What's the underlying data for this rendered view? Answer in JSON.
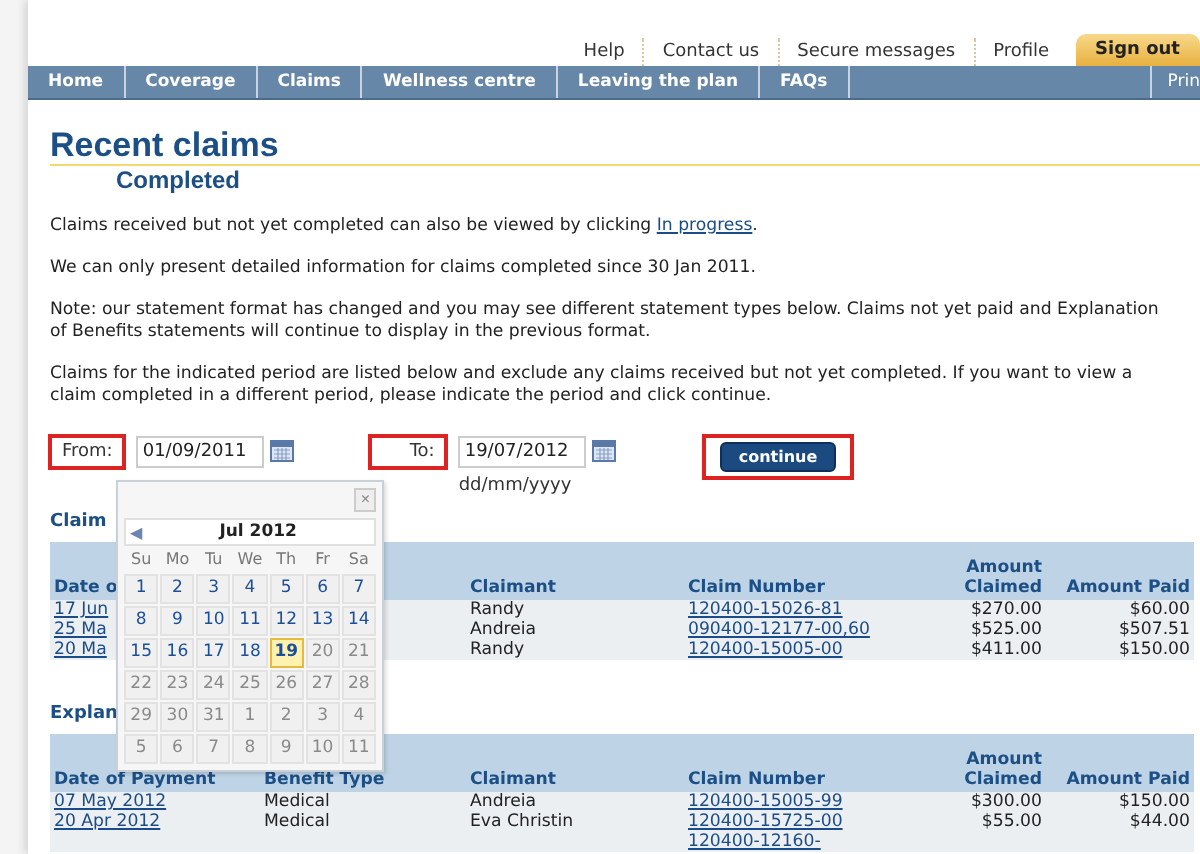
{
  "top_links": [
    {
      "label": "Help",
      "kind": "link"
    },
    {
      "label": "Contact us",
      "kind": "link"
    },
    {
      "label": "Secure messages",
      "kind": "link"
    },
    {
      "label": "Profile",
      "kind": "link"
    },
    {
      "label": "Sign out",
      "kind": "tab"
    }
  ],
  "nav": {
    "items": [
      "Home",
      "Coverage",
      "Claims",
      "Wellness centre",
      "Leaving the plan",
      "FAQs"
    ],
    "print": "Prin"
  },
  "heading": {
    "title": "Recent claims",
    "subtitle": "Completed"
  },
  "paragraphs": [
    {
      "text": "Claims received but not yet completed can also be viewed by clicking ",
      "link": "In progress",
      "after": "."
    },
    {
      "text": "We can only present detailed information for claims completed since 30 Jan 2011."
    },
    {
      "text": "Note: our statement format has changed and you may see different statement types below. Claims not yet paid and Explanation of Benefits statements will continue to display in the previous format."
    },
    {
      "text": "Claims for the indicated period are listed below and exclude any claims received but not yet completed. If you want to view a claim completed in a different period, please indicate the period and click continue."
    }
  ],
  "period": {
    "from_label": {
      "text": "From:",
      "highlighted": true
    },
    "from_value": "01/09/2011",
    "to_label": {
      "text": "To:",
      "highlighted": true
    },
    "to_value": "19/07/2012",
    "format_hint": "dd/mm/yyyy",
    "continue": {
      "label": "continue",
      "highlighted": true
    }
  },
  "calendar": {
    "close": "×",
    "prev": "◀",
    "month": "Jul 2012",
    "weekdays": [
      "Su",
      "Mo",
      "Tu",
      "We",
      "Th",
      "Fr",
      "Sa"
    ],
    "weeks": [
      [
        {
          "d": "1",
          "muted": false,
          "selected": false
        },
        {
          "d": "2",
          "muted": false,
          "selected": false
        },
        {
          "d": "3",
          "muted": false,
          "selected": false
        },
        {
          "d": "4",
          "muted": false,
          "selected": false
        },
        {
          "d": "5",
          "muted": false,
          "selected": false
        },
        {
          "d": "6",
          "muted": false,
          "selected": false
        },
        {
          "d": "7",
          "muted": false,
          "selected": false
        }
      ],
      [
        {
          "d": "8",
          "muted": false,
          "selected": false
        },
        {
          "d": "9",
          "muted": false,
          "selected": false
        },
        {
          "d": "10",
          "muted": false,
          "selected": false
        },
        {
          "d": "11",
          "muted": false,
          "selected": false
        },
        {
          "d": "12",
          "muted": false,
          "selected": false
        },
        {
          "d": "13",
          "muted": false,
          "selected": false
        },
        {
          "d": "14",
          "muted": false,
          "selected": false
        }
      ],
      [
        {
          "d": "15",
          "muted": false,
          "selected": false
        },
        {
          "d": "16",
          "muted": false,
          "selected": false
        },
        {
          "d": "17",
          "muted": false,
          "selected": false
        },
        {
          "d": "18",
          "muted": false,
          "selected": false
        },
        {
          "d": "19",
          "muted": false,
          "selected": true
        },
        {
          "d": "20",
          "muted": true,
          "selected": false
        },
        {
          "d": "21",
          "muted": true,
          "selected": false
        }
      ],
      [
        {
          "d": "22",
          "muted": true,
          "selected": false
        },
        {
          "d": "23",
          "muted": true,
          "selected": false
        },
        {
          "d": "24",
          "muted": true,
          "selected": false
        },
        {
          "d": "25",
          "muted": true,
          "selected": false
        },
        {
          "d": "26",
          "muted": true,
          "selected": false
        },
        {
          "d": "27",
          "muted": true,
          "selected": false
        },
        {
          "d": "28",
          "muted": true,
          "selected": false
        }
      ],
      [
        {
          "d": "29",
          "muted": true,
          "selected": false
        },
        {
          "d": "30",
          "muted": true,
          "selected": false
        },
        {
          "d": "31",
          "muted": true,
          "selected": false
        },
        {
          "d": "1",
          "muted": true,
          "selected": false
        },
        {
          "d": "2",
          "muted": true,
          "selected": false
        },
        {
          "d": "3",
          "muted": true,
          "selected": false
        },
        {
          "d": "4",
          "muted": true,
          "selected": false
        }
      ],
      [
        {
          "d": "5",
          "muted": true,
          "selected": false
        },
        {
          "d": "6",
          "muted": true,
          "selected": false
        },
        {
          "d": "7",
          "muted": true,
          "selected": false
        },
        {
          "d": "8",
          "muted": true,
          "selected": false
        },
        {
          "d": "9",
          "muted": true,
          "selected": false
        },
        {
          "d": "10",
          "muted": true,
          "selected": false
        },
        {
          "d": "11",
          "muted": true,
          "selected": false
        }
      ]
    ]
  },
  "claims": {
    "title": "Claim",
    "columns": {
      "date": "Date o",
      "claimant": "Claimant",
      "claim_number": "Claim Number",
      "amount_claimed": "Amount Claimed",
      "amount_paid": "Amount Paid"
    },
    "rows": [
      {
        "date": "17 Jun",
        "claimant": "Randy",
        "claim_number": "120400-15026-81",
        "amount_claimed": "$270.00",
        "amount_paid": "$60.00"
      },
      {
        "date": "25 Ma",
        "claimant": "Andreia",
        "claim_number": "090400-12177-00,60",
        "amount_claimed": "$525.00",
        "amount_paid": "$507.51"
      },
      {
        "date": "20 Ma",
        "claimant": "Randy",
        "claim_number": "120400-15005-00",
        "amount_claimed": "$411.00",
        "amount_paid": "$150.00"
      }
    ]
  },
  "statements": {
    "title": "Explan",
    "columns": {
      "date": "Date of Payment",
      "benefit_type": "Benefit Type",
      "claimant": "Claimant",
      "claim_number": "Claim Number",
      "amount_claimed": "Amount Claimed",
      "amount_paid": "Amount Paid"
    },
    "rows": [
      {
        "date": "07 May 2012",
        "benefit_type": "Medical",
        "claimant": "Andreia",
        "claim_number": "120400-15005-99",
        "amount_claimed": "$300.00",
        "amount_paid": "$150.00"
      },
      {
        "date": "20 Apr 2012",
        "benefit_type": "Medical",
        "claimant": "Eva Christin",
        "claim_number": "120400-15725-00",
        "amount_claimed": "$55.00",
        "amount_paid": "$44.00"
      },
      {
        "claim_number": "120400-12160-"
      }
    ]
  }
}
